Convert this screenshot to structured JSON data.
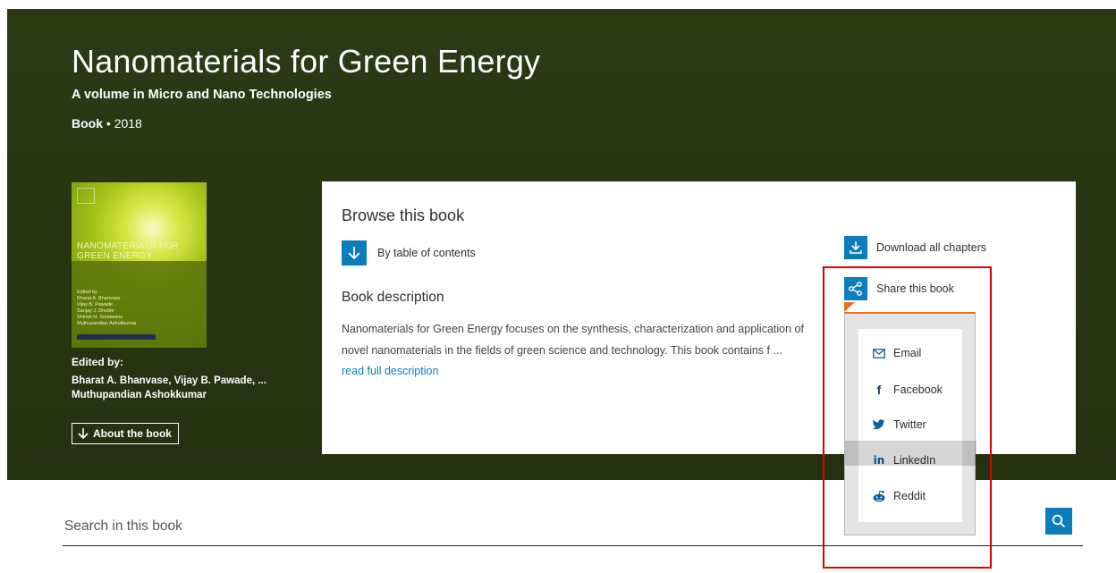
{
  "book": {
    "title": "Nanomaterials for Green Energy",
    "subtitle": "A volume in Micro and Nano Technologies",
    "type": "Book",
    "separator": "•",
    "year": "2018"
  },
  "cover": {
    "title": "NANOMATERIALS FOR GREEN ENERGY",
    "editors": [
      "Edited by",
      "Bharat A. Bhanvase",
      "Vijay B. Pawade",
      "Sanjay J. Dhoble",
      "Shirish H. Sonawane",
      "Muthupandian Ashokkumar"
    ]
  },
  "editors": {
    "label": "Edited by:",
    "names": "Bharat A. Bhanvase, Vijay B. Pawade, ... Muthupandian Ashokkumar"
  },
  "about_button": "About the book",
  "panel": {
    "browse_title": "Browse this book",
    "toc_label": "By table of contents",
    "desc_title": "Book description",
    "desc_text": "Nanomaterials for Green Energy focuses on the synthesis, characterization and application of novel nanomaterials in the fields of green science and technology. This book contains f ... ",
    "read_more": "read full description",
    "download_label": "Download all chapters",
    "share_label": "Share this book"
  },
  "share_menu": {
    "items": [
      {
        "label": "Email",
        "icon": "email-icon"
      },
      {
        "label": "Facebook",
        "icon": "facebook-icon"
      },
      {
        "label": "Twitter",
        "icon": "twitter-icon"
      },
      {
        "label": "LinkedIn",
        "icon": "linkedin-icon"
      },
      {
        "label": "Reddit",
        "icon": "reddit-icon"
      }
    ]
  },
  "search": {
    "placeholder": "Search in this book"
  },
  "colors": {
    "hero_bg": "#283512",
    "accent_blue": "#0c7dbb",
    "share_accent": "#e9711c",
    "highlight": "#e00000"
  }
}
